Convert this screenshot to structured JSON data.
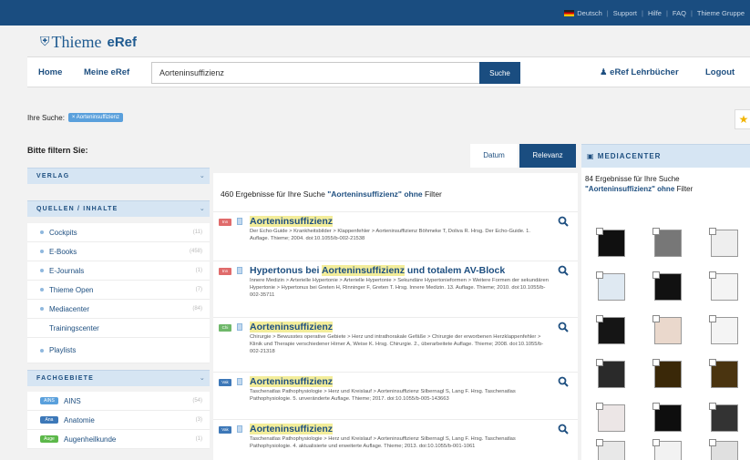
{
  "top_links": {
    "lang": "Deutsch",
    "support": "Support",
    "hilfe": "Hilfe",
    "faq": "FAQ",
    "gruppe": "Thieme Gruppe"
  },
  "logo": {
    "brand": "Thieme",
    "product": "eRef"
  },
  "nav": {
    "home": "Home",
    "meine": "Meine eRef",
    "search_value": "Aorteninsuffizienz",
    "search_button": "Suche",
    "lehrbuecher": "eRef Lehrbücher",
    "logout": "Logout"
  },
  "search_chip": {
    "label": "Ihre Suche:",
    "tag": "Aorteninsuffizienz"
  },
  "filters": {
    "title": "Bitte filtern Sie:",
    "verlag": "VERLAG",
    "quellen": "QUELLEN / INHALTE",
    "quellen_items": [
      {
        "label": "Cockpits",
        "count": "(11)"
      },
      {
        "label": "E-Books",
        "count": "(458)"
      },
      {
        "label": "E-Journals",
        "count": "(1)"
      },
      {
        "label": "Thieme Open",
        "count": "(7)"
      },
      {
        "label": "Mediacenter",
        "count": "(84)"
      },
      {
        "label": "Trainingscenter",
        "count": ""
      },
      {
        "label": "Playlists",
        "count": ""
      }
    ],
    "fachgebiete": "FACHGEBIETE",
    "fach_items": [
      {
        "badge": "AINS",
        "label": "AINS",
        "count": "(54)",
        "color": "#5aa0dc"
      },
      {
        "badge": "Ana",
        "label": "Anatomie",
        "count": "(3)",
        "color": "#3d78b8"
      },
      {
        "badge": "Auge",
        "label": "Augenheilkunde",
        "count": "(1)",
        "color": "#5cb84a"
      }
    ]
  },
  "sort": {
    "datum": "Datum",
    "relevanz": "Relevanz"
  },
  "results": {
    "count_text": "460 Ergebnisse für Ihre Suche",
    "query": "\"Aorteninsuffizienz\"",
    "filter_word": "ohne",
    "filter_tail": "Filter",
    "items": [
      {
        "badge": "Inn",
        "color": "#e06b6b",
        "pre": "",
        "hl": "Aorteninsuffizienz",
        "post": "",
        "desc": "Der Echo-Guide > Krankheitsbilder > Klappenfehler > Aorteninsuffizienz Böhmeke T, Doliva R. Hrsg. Der Echo-Guide. 1. Auflage. Thieme; 2004. doi:10.1055/b-002-21538"
      },
      {
        "badge": "Inn",
        "color": "#e06b6b",
        "pre": "Hypertonus bei ",
        "hl": "Aorteninsuffizienz",
        "post": " und totalem AV-Block",
        "desc": "Innere Medizin > Arterielle Hypertonie > Arterielle Hypertonie > Sekundäre Hypertonieformen > Weitere Formen der sekundären Hypertonie > Hypertonus bei Greten H, Rinninger F, Greten T. Hrsg. Innere Medizin. 13. Auflage. Thieme; 2010. doi:10.1055/b-002-35711"
      },
      {
        "badge": "Chi",
        "color": "#6fb86a",
        "pre": "",
        "hl": "Aorteninsuffizienz",
        "post": "",
        "desc": "Chirurgie > Bewusstes operative Gebiete > Herz und intrathorakale Gefäße > Chirurgie der erworbenen Herzklappenfehler > Klinik und Therapie verschiedener Hirner A, Weise K. Hrsg. Chirurgie. 2., überarbeitete Auflage. Thieme; 2008. doi:10.1055/b-002-21318"
      },
      {
        "badge": "Vak",
        "color": "#3d78b8",
        "pre": "",
        "hl": "Aorteninsuffizienz",
        "post": "",
        "desc": "Taschenatlas Pathophysiologie > Herz und Kreislauf > Aorteninsuffizienz Silbernagl S, Lang F. Hrsg. Taschenatlas Pathophysiologie. 5. unveränderte Auflage. Thieme; 2017. doi:10.1055/b-005-143663"
      },
      {
        "badge": "Vak",
        "color": "#3d78b8",
        "pre": "",
        "hl": "Aorteninsuffizienz",
        "post": "",
        "desc": "Taschenatlas Pathophysiologie > Herz und Kreislauf > Aorteninsuffizienz Silbernagl S, Lang F. Hrsg. Taschenatlas Pathophysiologie. 4. aktualisierte und erweiterte Auflage. Thieme; 2013. doi:10.1055/b-001-1061"
      }
    ]
  },
  "mediacenter": {
    "title": "MEDIACENTER",
    "text_pre": "84 Ergebnisse für Ihre Suche",
    "query": "\"Aorteninsuffizienz\"",
    "filter_word": "ohne",
    "filter_tail": "Filter"
  }
}
